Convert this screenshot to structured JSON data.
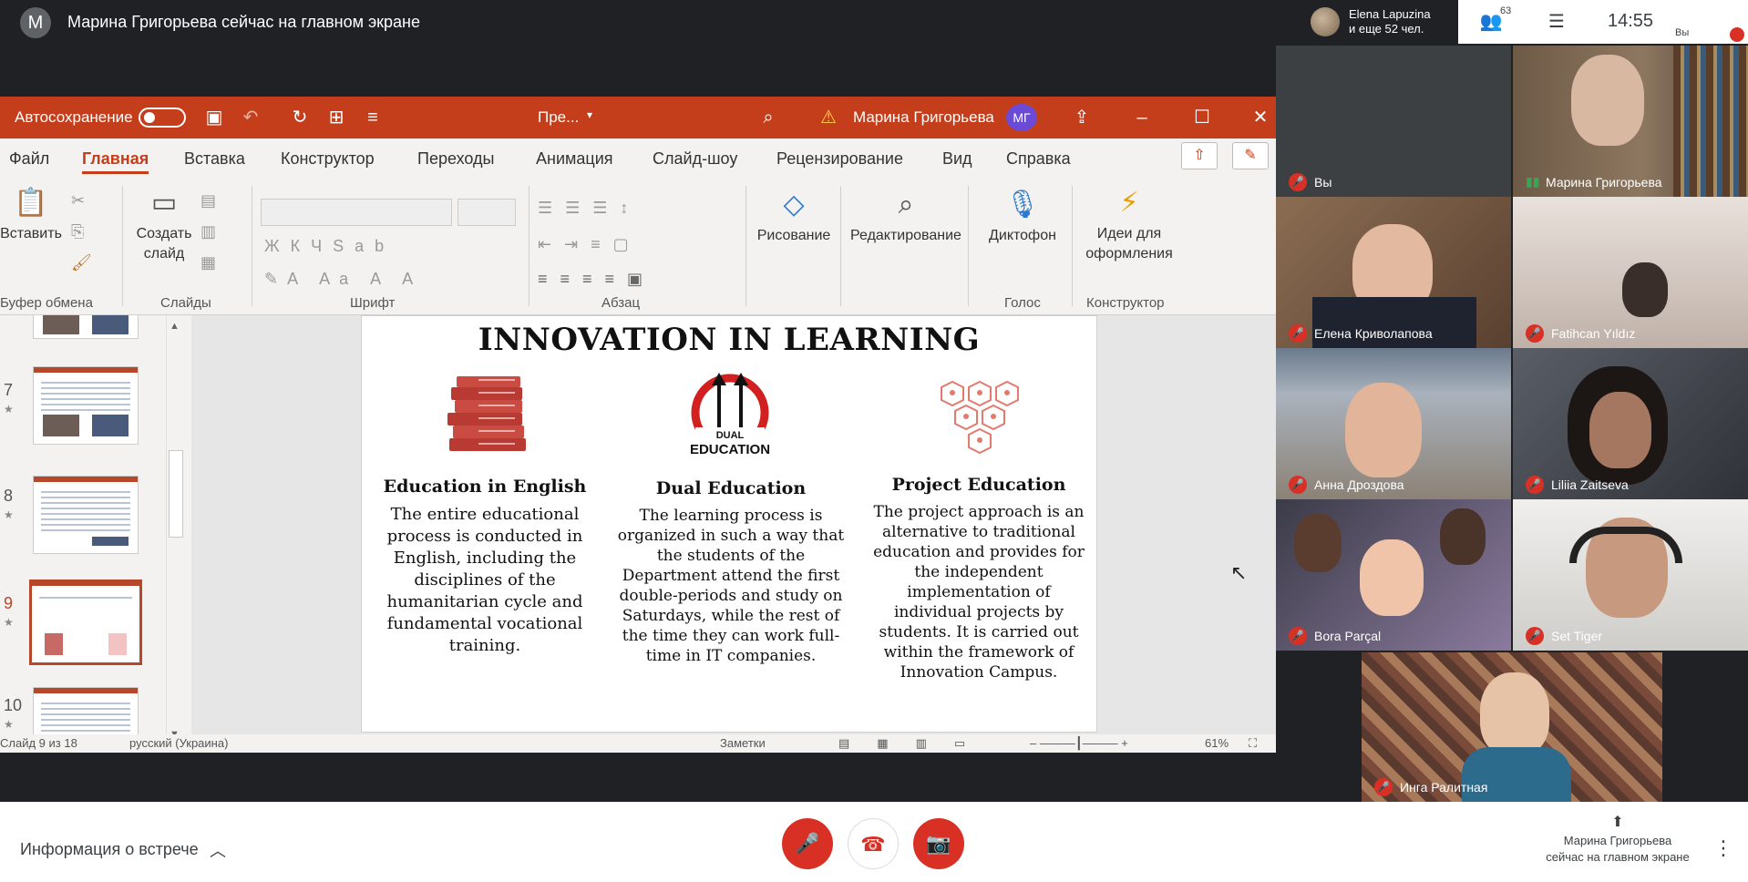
{
  "meet": {
    "presenter_avatar": "М",
    "presenter_text": "Марина Григорьева сейчас на главном экране",
    "people_chip_line1": "Elena Lapuzina",
    "people_chip_line2": "и еще 52 чел.",
    "participants_count": "63",
    "clock": "14:55",
    "you_label": "Вы",
    "meeting_info": "Информация о встрече",
    "presenting_line1": "Марина Григорьева",
    "presenting_line2": "сейчас на главном экране"
  },
  "ppt": {
    "autosave": "Автосохранение",
    "filename": "Пре...",
    "user_name": "Марина Григорьева",
    "user_initials": "МГ",
    "menu": [
      "Файл",
      "Главная",
      "Вставка",
      "Конструктор",
      "Переходы",
      "Анимация",
      "Слайд-шоу",
      "Рецензирование",
      "Вид",
      "Справка"
    ],
    "ribbon": {
      "paste": "Вставить",
      "new_slide_1": "Создать",
      "new_slide_2": "слайд",
      "drawing": "Рисование",
      "editing": "Редактирование",
      "dictate": "Диктофон",
      "ideas_1": "Идеи для",
      "ideas_2": "оформления",
      "groups": [
        "Буфер обмена",
        "Слайды",
        "Шрифт",
        "Абзац",
        "Голос",
        "Конструктор"
      ]
    },
    "thumb_numbers": [
      "7",
      "8",
      "9",
      "10"
    ],
    "status_slide": "Слайд 9 из 18",
    "status_lang": "русский (Украина)",
    "status_notes": "Заметки",
    "status_zoom": "61%"
  },
  "slide": {
    "title": "INNOVATION IN LEARNING",
    "columns": [
      {
        "heading": "Education in English",
        "body": "The entire educational process is conducted in English, including the disciplines of the humanitarian cycle and fundamental vocational training."
      },
      {
        "heading": "Dual Education",
        "icon_line1": "DUAL",
        "icon_line2": "EDUCATION",
        "body": "The learning process is organized in such a way that the students of the Department attend the first double-periods and study on Saturdays, while the rest of the time they can work full-time in IT companies."
      },
      {
        "heading": "Project Education",
        "body": "The project approach is an alternative to traditional education and provides for the independent implementation of individual projects by students. It is carried out within the framework of Innovation Campus."
      }
    ]
  },
  "participants": [
    {
      "name": "Вы"
    },
    {
      "name": "Марина Григорьева"
    },
    {
      "name": "Елена Криволапова"
    },
    {
      "name": "Fatihcan Yıldız"
    },
    {
      "name": "Анна Дроздова"
    },
    {
      "name": "Liliia Zaitseva"
    },
    {
      "name": "Bora Parçal"
    },
    {
      "name": "Set Tiger"
    },
    {
      "name": "Инга Ралитная"
    }
  ]
}
